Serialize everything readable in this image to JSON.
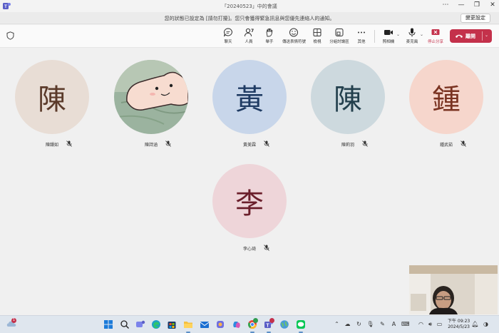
{
  "window": {
    "title": "「20240523」中的會議",
    "controls": [
      "⋯",
      "—",
      "❐",
      "✕"
    ]
  },
  "notice": {
    "text": "您的狀態已設定為 [請勿打擾]。您只會獲得緊急訊息與您優先連絡人的通知。",
    "button": "變更設定"
  },
  "toolbar": {
    "buttons": [
      {
        "label": "聊天",
        "icon": "chat-icon"
      },
      {
        "label": "人員",
        "icon": "people-icon",
        "count": "7"
      },
      {
        "label": "舉手",
        "icon": "raise-hand-icon"
      },
      {
        "label": "傳送表情符號",
        "icon": "emoji-icon"
      },
      {
        "label": "檢視",
        "icon": "view-grid-icon"
      },
      {
        "label": "分組討論區",
        "icon": "breakout-rooms-icon"
      },
      {
        "label": "其他",
        "icon": "more-icon"
      },
      {
        "label": "照相機",
        "icon": "camera-icon"
      },
      {
        "label": "麥克風",
        "icon": "microphone-icon"
      },
      {
        "label": "停止分享",
        "icon": "stop-share-icon"
      }
    ],
    "leave_label": "離開"
  },
  "participants": [
    {
      "name": "陳韻如",
      "initial": "陳",
      "bg": "#e8ddd5",
      "fg": "#5b3a2a"
    },
    {
      "name": "陳詩涵",
      "initial": "",
      "bg": "#9bb3a0",
      "fg": "#333"
    },
    {
      "name": "黃美霖",
      "initial": "黃",
      "bg": "#c8d6ea",
      "fg": "#1f3b63"
    },
    {
      "name": "陳莉羽",
      "initial": "陳",
      "bg": "#cdd9de",
      "fg": "#23404d"
    },
    {
      "name": "鍾武茹",
      "initial": "鍾",
      "bg": "#f6d6cc",
      "fg": "#7a3321"
    },
    {
      "name": "李心琦",
      "initial": "李",
      "bg": "#eed5d9",
      "fg": "#6b1f2c"
    }
  ],
  "taskbar": {
    "notification_count": "1",
    "chrome_badge": "",
    "teams_badge": "",
    "clock_time": "下午 09:23",
    "clock_date": "2024/5/23",
    "colors": {
      "accent": "#c4314b",
      "teams": "#5b5fc7"
    }
  }
}
